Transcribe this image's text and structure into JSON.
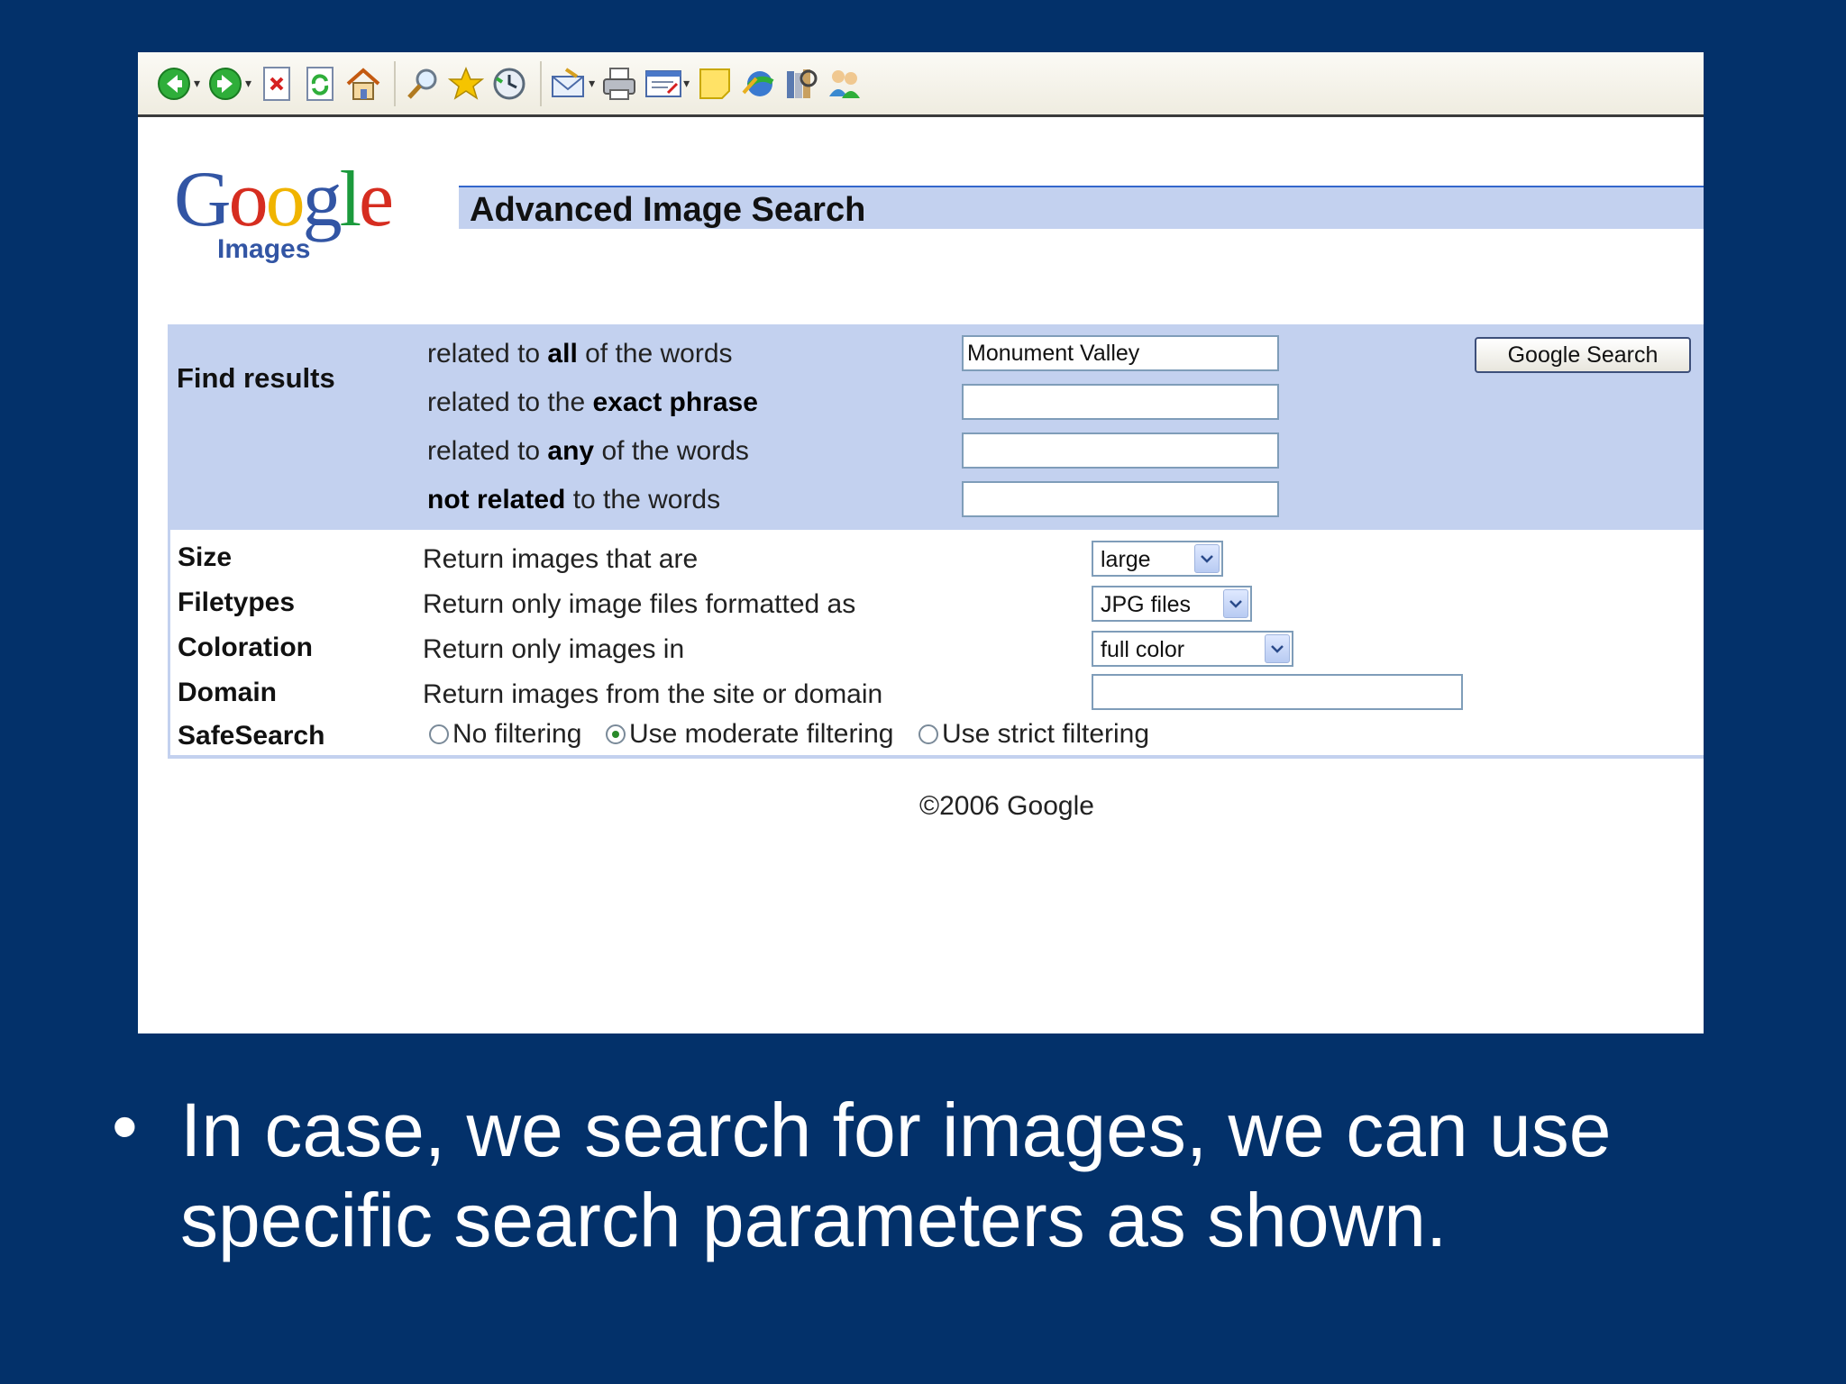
{
  "page": {
    "title": "Advanced Image Search",
    "logo_word": "Google",
    "logo_sub": "Images"
  },
  "toolbar": {
    "icons": [
      "back-icon",
      "forward-icon",
      "stop-icon",
      "refresh-icon",
      "home-icon",
      "search-icon",
      "favorites-icon",
      "history-icon",
      "mail-icon",
      "print-icon",
      "edit-icon",
      "note-icon",
      "messenger-icon",
      "research-icon",
      "contacts-icon"
    ]
  },
  "find": {
    "label": "Find results",
    "rows": [
      {
        "pre": "related to ",
        "bold": "all",
        "post": " of the words",
        "value": "Monument Valley"
      },
      {
        "pre": "related to the ",
        "bold": "exact phrase",
        "post": "",
        "value": ""
      },
      {
        "pre": "related to ",
        "bold": "any",
        "post": " of the words",
        "value": ""
      },
      {
        "pre": "",
        "bold": "not related",
        "post": " to the words",
        "value": ""
      }
    ],
    "button": "Google Search"
  },
  "options": {
    "size": {
      "label": "Size",
      "desc": "Return images that are",
      "value": "large"
    },
    "filetypes": {
      "label": "Filetypes",
      "desc": "Return only image files formatted as",
      "value": "JPG files"
    },
    "coloration": {
      "label": "Coloration",
      "desc": "Return only images in",
      "value": "full color"
    },
    "domain": {
      "label": "Domain",
      "desc": "Return images from the site or domain",
      "value": ""
    },
    "safesearch": {
      "label": "SafeSearch",
      "choices": [
        "No filtering",
        "Use moderate filtering",
        "Use strict filtering"
      ],
      "selected": "Use moderate filtering"
    }
  },
  "footer": {
    "copyright": "©2006 Google"
  },
  "slide": {
    "bullet": "•",
    "text": "In case, we search for images, we can use specific search parameters as shown."
  },
  "colors": {
    "slide_bg": "#03316a",
    "panel_blue": "#c3d1ef",
    "logo_blue": "#3255a4",
    "logo_red": "#d62d20",
    "logo_yellow": "#f0b400",
    "logo_green": "#1b9a3c"
  }
}
